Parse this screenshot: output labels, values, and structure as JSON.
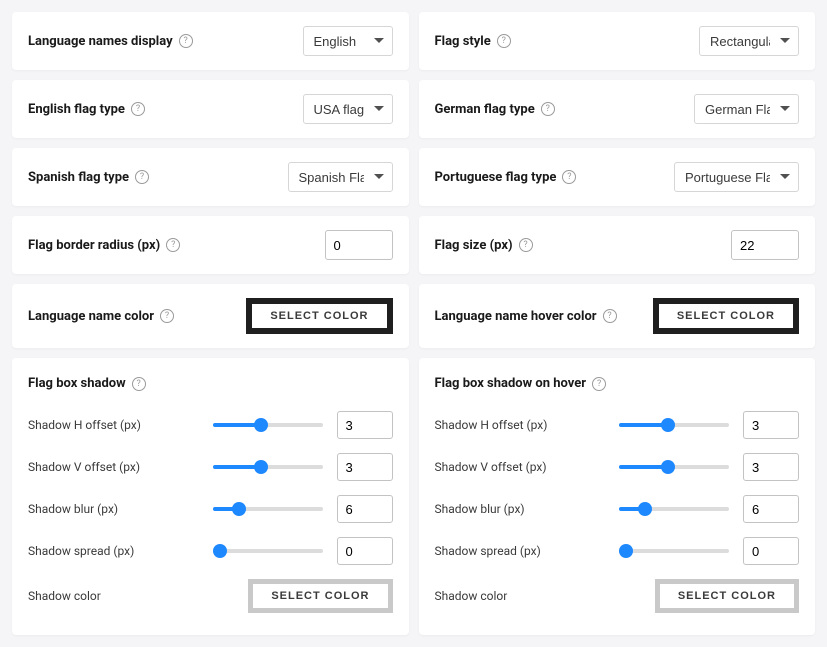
{
  "select_color_label": "SELECT COLOR",
  "left": {
    "lang_names_display": {
      "label": "Language names display",
      "value": "English"
    },
    "english_flag": {
      "label": "English flag type",
      "value": "USA flag"
    },
    "spanish_flag": {
      "label": "Spanish flag type",
      "value": "Spanish Flag"
    },
    "flag_border_radius": {
      "label": "Flag border radius (px)",
      "value": "0"
    },
    "lang_name_color": {
      "label": "Language name color"
    }
  },
  "right": {
    "flag_style": {
      "label": "Flag style",
      "value": "Rectangular"
    },
    "german_flag": {
      "label": "German flag type",
      "value": "German Flag"
    },
    "portuguese_flag": {
      "label": "Portuguese flag type",
      "value": "Portuguese Flag"
    },
    "flag_size": {
      "label": "Flag size (px)",
      "value": "22"
    },
    "lang_name_hover_color": {
      "label": "Language name hover color"
    }
  },
  "shadow_left": {
    "title": "Flag box shadow",
    "h_offset": {
      "label": "Shadow H offset (px)",
      "value": "3",
      "min": "-10",
      "max": "20"
    },
    "v_offset": {
      "label": "Shadow V offset (px)",
      "value": "3",
      "min": "-10",
      "max": "20"
    },
    "blur": {
      "label": "Shadow blur (px)",
      "value": "6",
      "min": "0",
      "max": "30"
    },
    "spread": {
      "label": "Shadow spread (px)",
      "value": "0",
      "min": "0",
      "max": "30"
    },
    "color_label": "Shadow color"
  },
  "shadow_right": {
    "title": "Flag box shadow on hover",
    "h_offset": {
      "label": "Shadow H offset (px)",
      "value": "3",
      "min": "-10",
      "max": "20"
    },
    "v_offset": {
      "label": "Shadow V offset (px)",
      "value": "3",
      "min": "-10",
      "max": "20"
    },
    "blur": {
      "label": "Shadow blur (px)",
      "value": "6",
      "min": "0",
      "max": "30"
    },
    "spread": {
      "label": "Shadow spread (px)",
      "value": "0",
      "min": "0",
      "max": "30"
    },
    "color_label": "Shadow color"
  }
}
